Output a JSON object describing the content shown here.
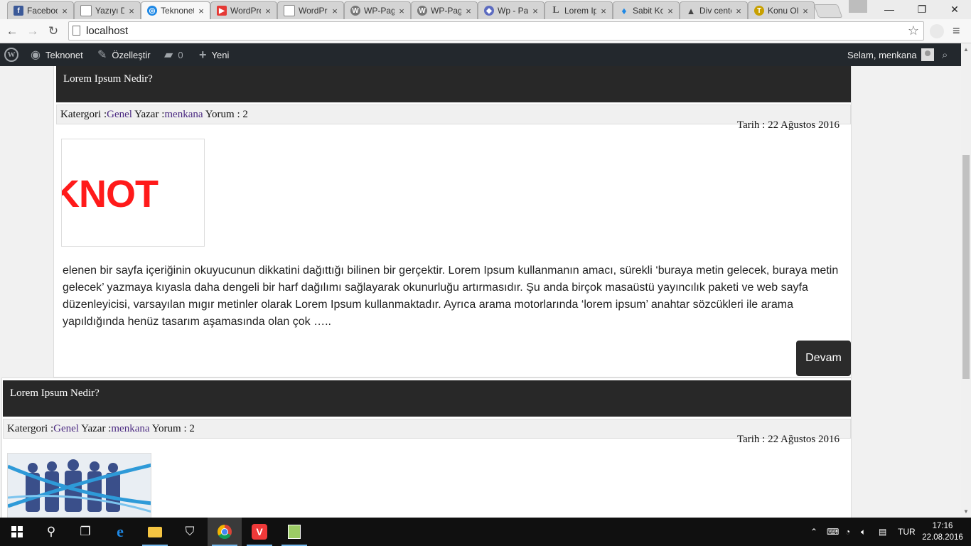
{
  "browser": {
    "tabs": [
      {
        "title": "Facebook",
        "favicon": "facebook-icon",
        "color": "#3b5998",
        "active": false
      },
      {
        "title": "Yazıyı Düzenle",
        "favicon": "page-icon",
        "color": "#9e9e9e",
        "active": false
      },
      {
        "title": "Teknonet",
        "favicon": "site-icon",
        "color": "#1e88e5",
        "active": true
      },
      {
        "title": "WordPress",
        "favicon": "youtube-icon",
        "color": "#e53935",
        "active": false
      },
      {
        "title": "WordPress",
        "favicon": "page-icon",
        "color": "#9e9e9e",
        "active": false
      },
      {
        "title": "WP-PageNavi",
        "favicon": "wordpress-icon",
        "color": "#777777",
        "active": false
      },
      {
        "title": "WP-PageNavi",
        "favicon": "wordpress-icon",
        "color": "#777777",
        "active": false
      },
      {
        "title": "Wp - Pagination",
        "favicon": "php-icon",
        "color": "#5c6bc0",
        "active": false
      },
      {
        "title": "Lorem Ipsum",
        "favicon": "lorem-icon",
        "color": "#555555",
        "active": false
      },
      {
        "title": "Sabit Konum",
        "favicon": "drop-icon",
        "color": "#1e88e5",
        "active": false
      },
      {
        "title": "Div center",
        "favicon": "stack-icon",
        "color": "#444444",
        "active": false
      },
      {
        "title": "Konu Oluştur",
        "favicon": "forum-icon",
        "color": "#c8a000",
        "active": false
      }
    ],
    "url": "localhost"
  },
  "adminbar": {
    "site_name": "Teknonet",
    "customize": "Özelleştir",
    "comments_count": "0",
    "new": "Yeni",
    "greeting": "Selam, menkana"
  },
  "posts": [
    {
      "title": "Lorem Ipsum Nedir?",
      "category_label": "Katergori :",
      "category": "Genel",
      "author_label": " Yazar :",
      "author": "menkana",
      "comments_label": " Yorum : 2",
      "date": "Tarih : 22 Ağustos 2016",
      "thumb_text": "KNOT",
      "excerpt": "elenen bir sayfa içeriğinin okuyucunun dikkatini dağıttığı bilinen bir gerçektir. Lorem Ipsum kullanmanın amacı, sürekli ‘buraya metin gelecek, buraya metin gelecek’ yazmaya kıyasla daha dengeli bir harf dağılımı sağlayarak okunurluğu artırmasıdır. Şu anda birçok masaüstü yayıncılık paketi ve web sayfa düzenleyicisi, varsayılan mıgır metinler olarak Lorem Ipsum kullanmaktadır. Ayrıca arama motorlarında ‘lorem ipsum’ anahtar sözcükleri ile arama yapıldığında henüz tasarım aşamasında olan çok …..",
      "more": "Devam"
    },
    {
      "title": "Lorem Ipsum Nedir?",
      "category_label": "Katergori :",
      "category": "Genel",
      "author_label": " Yazar :",
      "author": "menkana",
      "comments_label": " Yorum : 2",
      "date": "Tarih : 22 Ağustos 2016"
    }
  ],
  "taskbar": {
    "language": "TUR",
    "time": "17:16",
    "date": "22.08.2016"
  },
  "colors": {
    "adminbar": "#23282d",
    "title_bar": "#282828",
    "link": "#4b2a82",
    "thumb_red": "#ff1a1a"
  }
}
